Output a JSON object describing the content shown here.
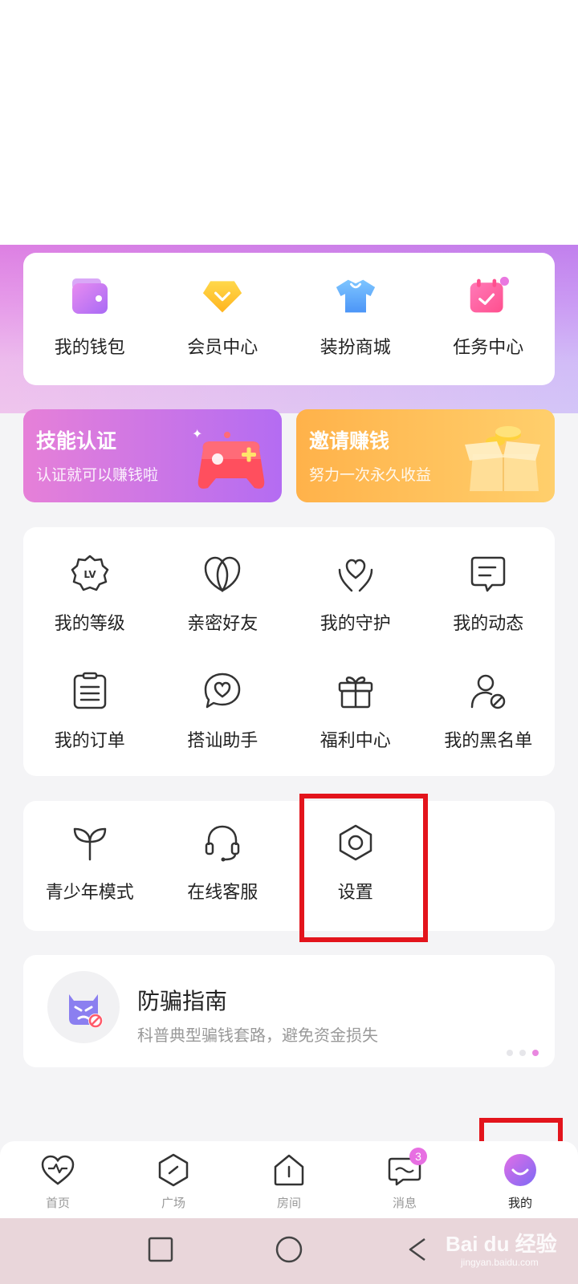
{
  "quick_actions": [
    {
      "label": "我的钱包",
      "icon": "wallet-icon"
    },
    {
      "label": "会员中心",
      "icon": "diamond-icon"
    },
    {
      "label": "装扮商城",
      "icon": "tshirt-icon"
    },
    {
      "label": "任务中心",
      "icon": "calendar-check-icon"
    }
  ],
  "promos": [
    {
      "title": "技能认证",
      "subtitle": "认证就可以赚钱啦",
      "icon": "gamepad-icon"
    },
    {
      "title": "邀请赚钱",
      "subtitle": "努力一次永久收益",
      "icon": "gift-box-coins-icon"
    }
  ],
  "features": [
    {
      "label": "我的等级",
      "icon": "level-badge-icon"
    },
    {
      "label": "亲密好友",
      "icon": "intimate-friends-icon"
    },
    {
      "label": "我的守护",
      "icon": "guard-heart-icon"
    },
    {
      "label": "我的动态",
      "icon": "posts-icon"
    },
    {
      "label": "我的订单",
      "icon": "orders-icon"
    },
    {
      "label": "搭讪助手",
      "icon": "chat-heart-icon"
    },
    {
      "label": "福利中心",
      "icon": "gift-icon"
    },
    {
      "label": "我的黑名单",
      "icon": "blocked-user-icon"
    }
  ],
  "tools": [
    {
      "label": "青少年模式",
      "icon": "sprout-icon"
    },
    {
      "label": "在线客服",
      "icon": "headset-icon"
    },
    {
      "label": "设置",
      "icon": "settings-hexagon-icon"
    }
  ],
  "guide": {
    "title": "防骗指南",
    "subtitle": "科普典型骗钱套路，避免资金损失",
    "icon": "anti-fraud-devil-icon"
  },
  "tabs": [
    {
      "label": "首页",
      "icon": "heartbeat-icon"
    },
    {
      "label": "广场",
      "icon": "square-icon"
    },
    {
      "label": "房间",
      "icon": "house-icon"
    },
    {
      "label": "消息",
      "icon": "message-icon",
      "badge": "3"
    },
    {
      "label": "我的",
      "icon": "profile-smile-icon",
      "active": true
    }
  ],
  "watermark": {
    "brand": "Bai du 经验",
    "domain": "jingyan.baidu.com"
  },
  "colors": {
    "accent": "#b46cf2",
    "highlight": "#e3141c",
    "badge": "#e76fe2"
  }
}
